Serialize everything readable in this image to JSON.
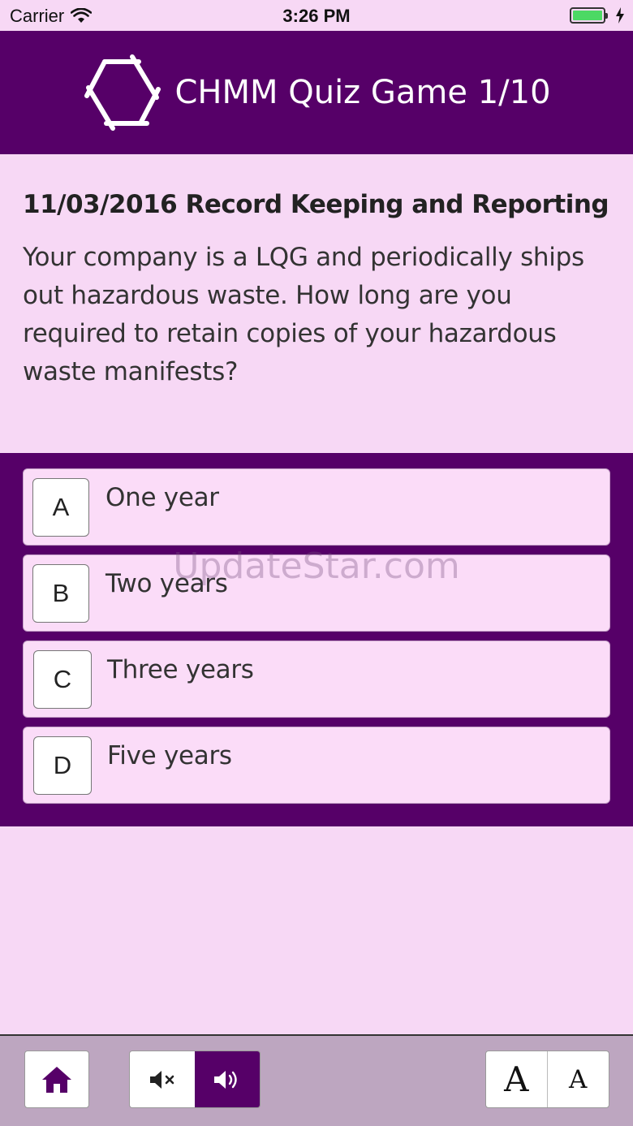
{
  "status": {
    "carrier": "Carrier",
    "time": "3:26 PM"
  },
  "header": {
    "title": "CHMM Quiz Game 1/10",
    "icon": "hexagon-logo-icon"
  },
  "question": {
    "heading": "11/03/2016 Record Keeping and Reporting",
    "text": "Your company is a LQG and periodically ships out hazardous waste.  How long are you required to retain copies of your hazardous waste manifests?"
  },
  "answers": [
    {
      "letter": "A",
      "text": "One year"
    },
    {
      "letter": "B",
      "text": "Two years"
    },
    {
      "letter": "C",
      "text": "Three years"
    },
    {
      "letter": "D",
      "text": "Five years"
    }
  ],
  "watermark": "UpdateStar.com",
  "toolbar": {
    "font_large": "A",
    "font_small": "A",
    "icons": [
      "home-icon",
      "mute-icon",
      "speaker-icon"
    ]
  },
  "colors": {
    "brand_purple": "#560068",
    "background": "#f7d8f5",
    "answer_bg": "#fbdcf8",
    "toolbar_bg": "#bda6c0"
  }
}
